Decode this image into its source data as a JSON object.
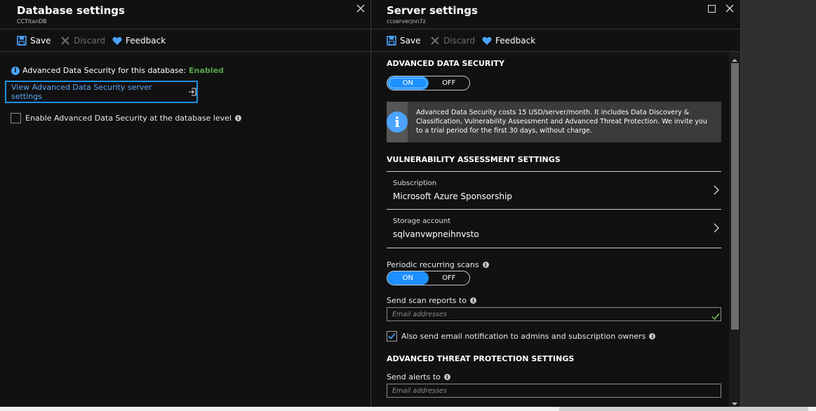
{
  "db_blade": {
    "title": "Database settings",
    "subtitle": "CCTitanDB",
    "toolbar": {
      "save": "Save",
      "discard": "Discard",
      "feedback": "Feedback"
    },
    "status_label": "Advanced Data Security for this database:",
    "status_value": "Enabled",
    "server_link": "View Advanced Data Security server settings",
    "enable_checkbox_label": "Enable Advanced Data Security at the database level",
    "enable_checked": false
  },
  "server_blade": {
    "title": "Server settings",
    "subtitle": "ccserverjnn7z",
    "toolbar": {
      "save": "Save",
      "discard": "Discard",
      "feedback": "Feedback"
    },
    "ads_section": "ADVANCED DATA SECURITY",
    "ads_toggle": {
      "on": "ON",
      "off": "OFF",
      "value": "ON"
    },
    "info_message": "Advanced Data Security costs 15 USD/server/month. It includes Data Discovery & Classification, Vulnerability Assessment and Advanced Threat Protection. We invite you to a trial period for the first 30 days, without charge.",
    "va_section": "VULNERABILITY ASSESSMENT SETTINGS",
    "subscription": {
      "label": "Subscription",
      "value": "Microsoft Azure Sponsorship"
    },
    "storage": {
      "label": "Storage account",
      "value": "sqlvanvwpneihnvsto"
    },
    "periodic_label": "Periodic recurring scans",
    "periodic_toggle": {
      "on": "ON",
      "off": "OFF",
      "value": "ON"
    },
    "send_reports_label": "Send scan reports to",
    "email_placeholder": "Email addresses",
    "also_send_label": "Also send email notification to admins and subscription owners",
    "also_send_checked": true,
    "atp_section": "ADVANCED THREAT PROTECTION SETTINGS",
    "send_alerts_label": "Send alerts to",
    "alerts_placeholder": "Email addresses"
  },
  "colors": {
    "accent": "#1e90ff",
    "link": "#5fa8f5",
    "enabled": "#57a64a",
    "focus_border": "#1e90e0"
  }
}
